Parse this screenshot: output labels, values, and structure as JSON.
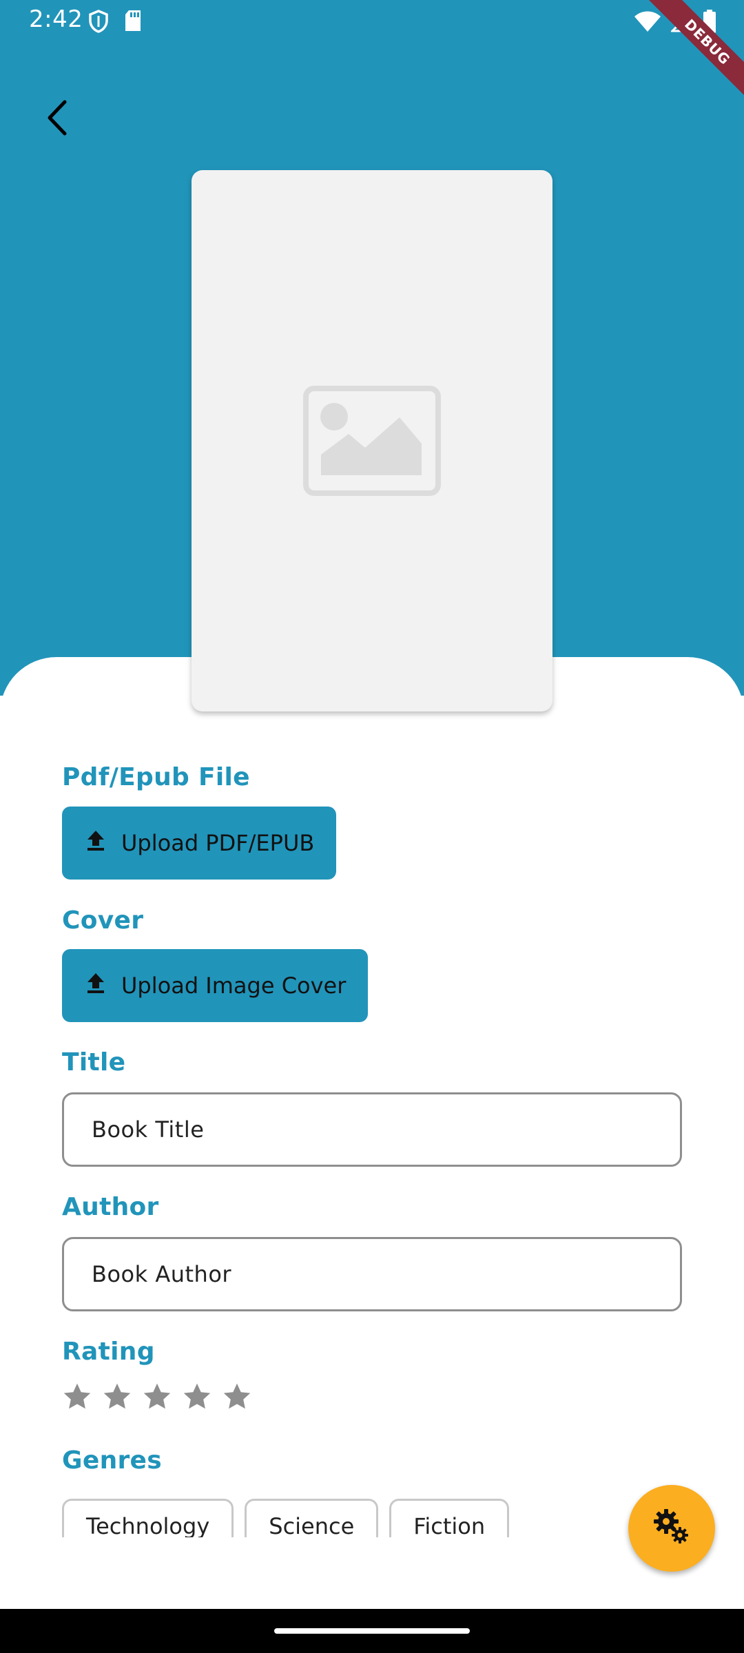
{
  "status_bar": {
    "time": "2:42",
    "left_icons": [
      "shield-icon",
      "sd-card-icon"
    ],
    "right_icons": [
      "wifi-icon",
      "signal-icon",
      "battery-icon"
    ]
  },
  "debug_banner": "DEBUG",
  "cover_preview": {
    "placeholder_icon": "image-placeholder-icon"
  },
  "sections": {
    "file": {
      "label": "Pdf/Epub File",
      "button_label": "Upload PDF/EPUB",
      "button_icon": "upload-icon"
    },
    "cover": {
      "label": "Cover",
      "button_label": "Upload Image Cover",
      "button_icon": "upload-icon"
    },
    "title": {
      "label": "Title",
      "placeholder": "Book Title"
    },
    "author": {
      "label": "Author",
      "placeholder": "Book Author"
    },
    "rating": {
      "label": "Rating",
      "value": 0,
      "max": 5
    },
    "genres": {
      "label": "Genres",
      "items": [
        "Technology",
        "Science",
        "Fiction"
      ]
    }
  },
  "fab": {
    "icon": "settings-gears-icon"
  },
  "colors": {
    "primary": "#2194BA",
    "accent": "#FBAE20",
    "star": "#8E8E8E",
    "placeholder_bg": "#F2F2F2"
  }
}
